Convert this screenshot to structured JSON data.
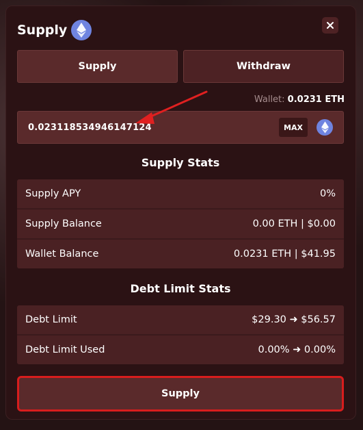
{
  "modal": {
    "title": "Supply",
    "icons": {
      "title_token": "ethereum-icon",
      "close": "close-icon"
    }
  },
  "tabs": [
    {
      "label": "Supply",
      "active": true
    },
    {
      "label": "Withdraw",
      "active": false
    }
  ],
  "wallet": {
    "label": "Wallet:",
    "value": "0.0231 ETH"
  },
  "amount_input": {
    "value": "0.023118534946147124",
    "max_label": "MAX",
    "token_icon": "ethereum-icon"
  },
  "supply_stats": {
    "title": "Supply Stats",
    "rows": [
      {
        "label": "Supply APY",
        "value": "0%"
      },
      {
        "label": "Supply Balance",
        "value": "0.00 ETH | $0.00"
      },
      {
        "label": "Wallet Balance",
        "value": "0.0231 ETH | $41.95"
      }
    ]
  },
  "debt_stats": {
    "title": "Debt Limit Stats",
    "rows": [
      {
        "label": "Debt Limit",
        "value": "$29.30 ➜ $56.57"
      },
      {
        "label": "Debt Limit Used",
        "value": "0.00% ➜ 0.00%"
      }
    ]
  },
  "submit": {
    "label": "Supply"
  },
  "colors": {
    "modal_bg": "#2b1214",
    "panel": "#5a2a2b",
    "row": "#4a2123",
    "highlight_border": "#d81d1d",
    "eth_badge": "#6f84e0",
    "annotation_arrow": "#e02020"
  }
}
